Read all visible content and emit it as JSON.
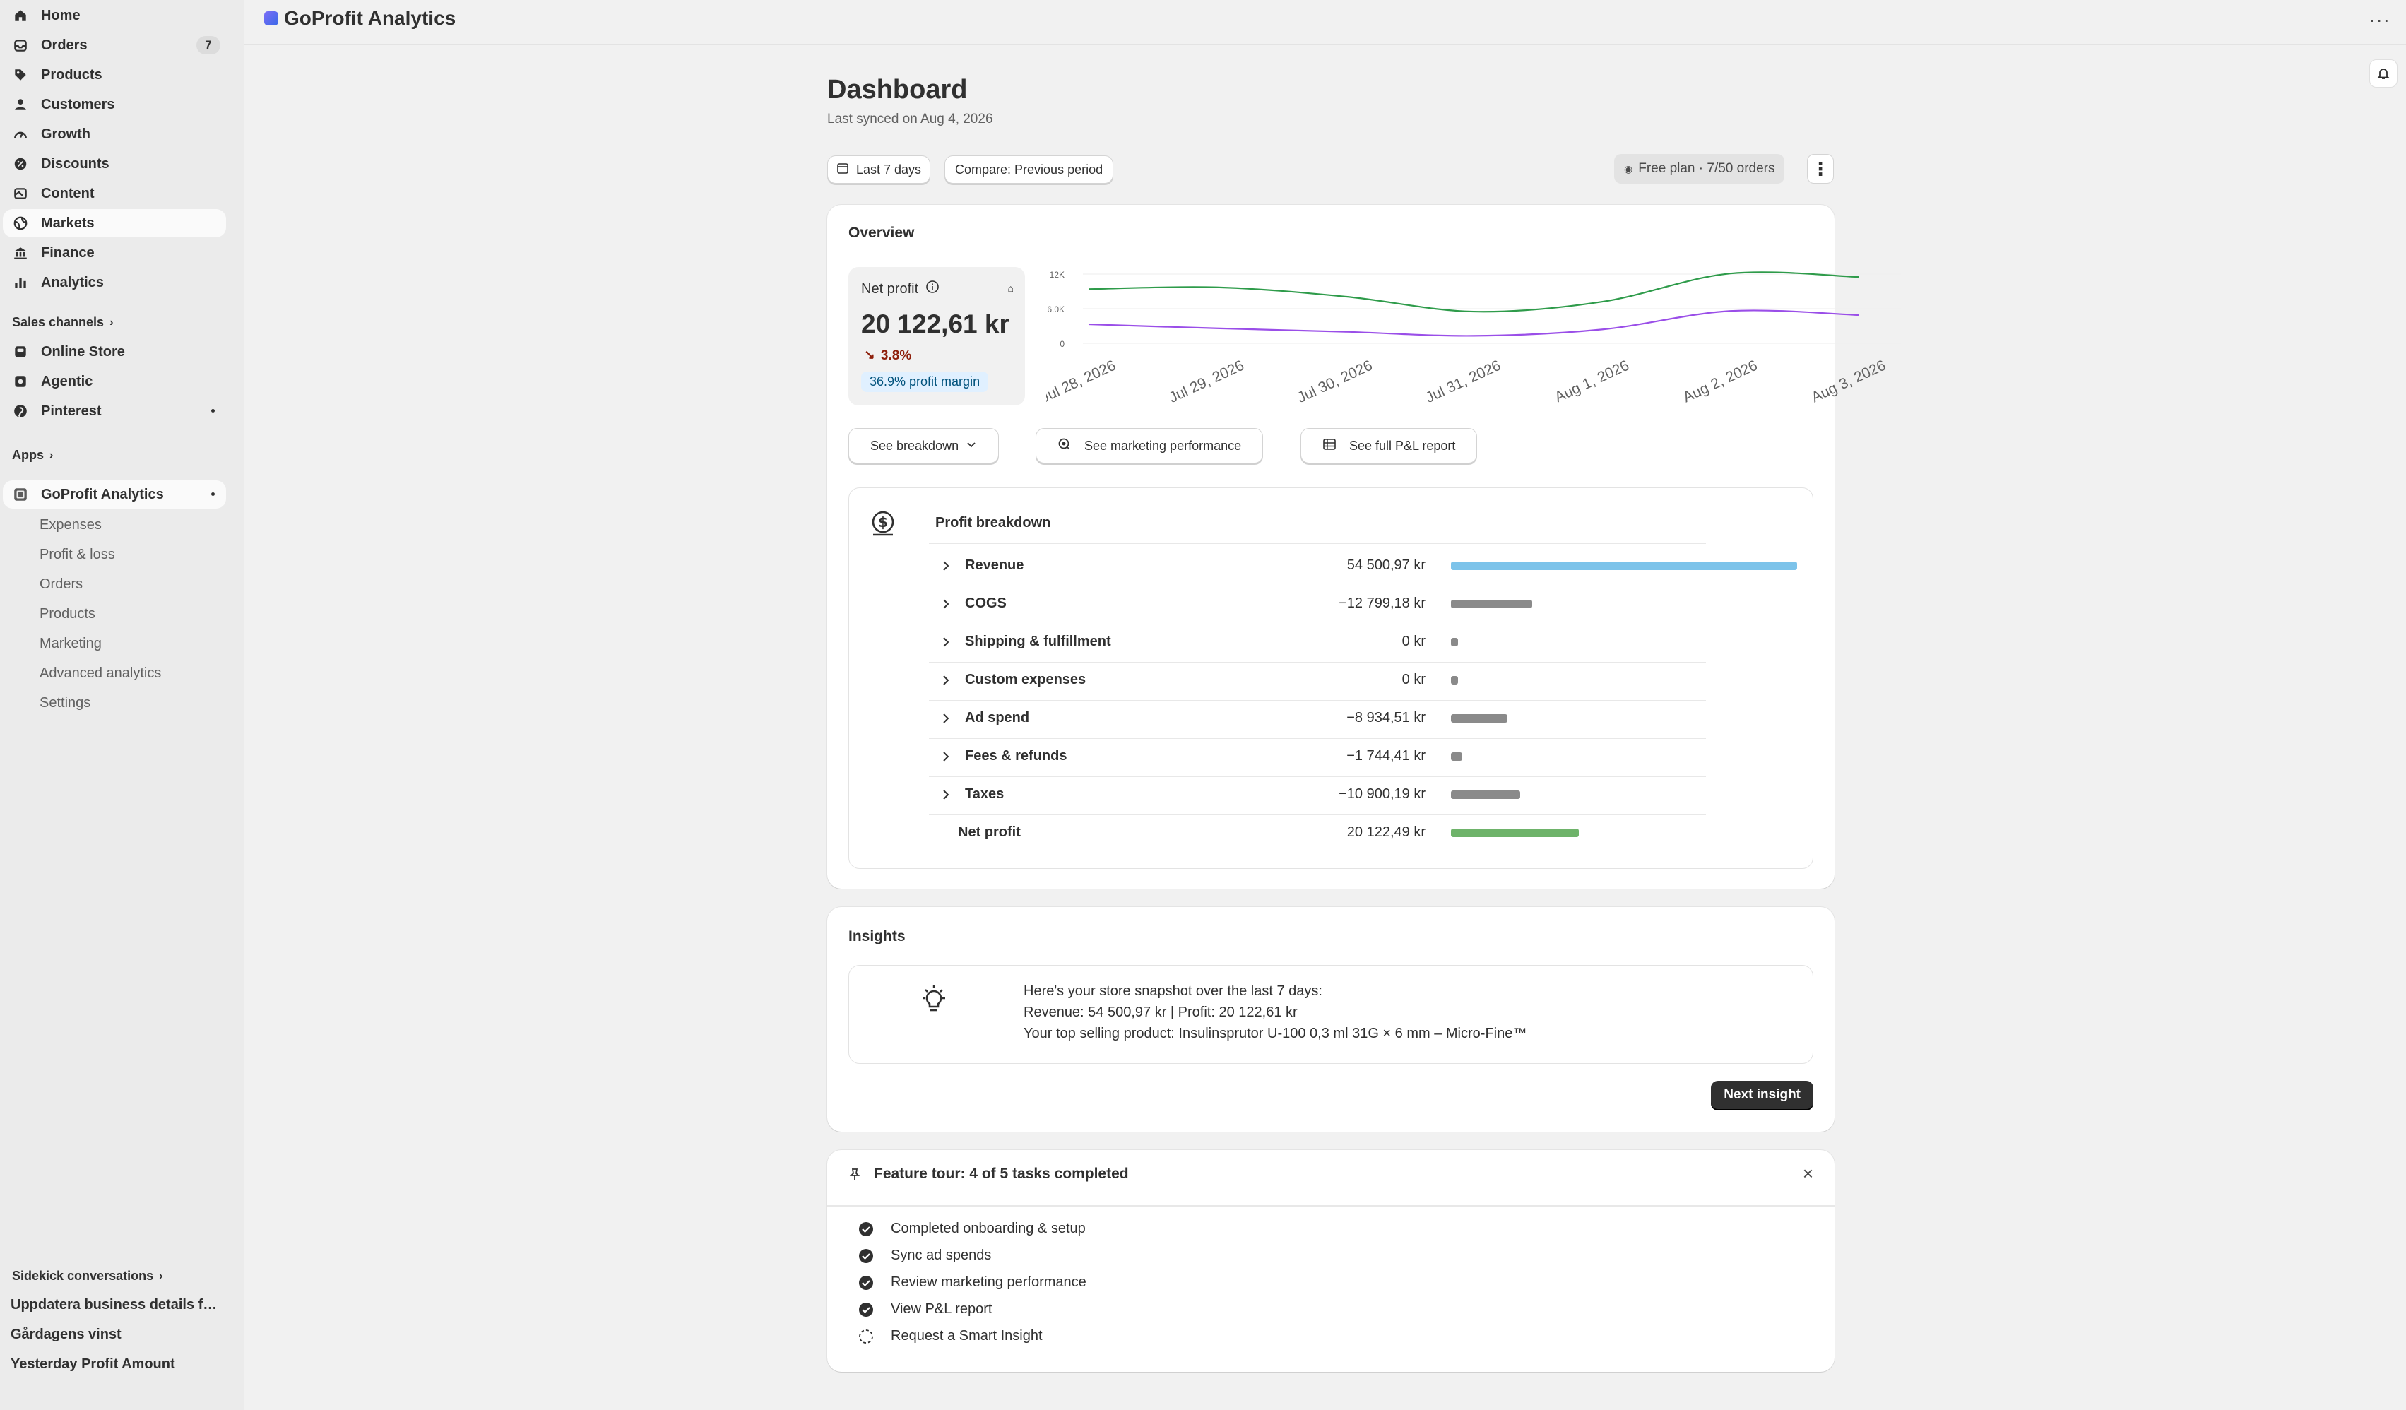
{
  "sidebar": {
    "items": [
      {
        "label": "Home",
        "icon": "home-icon"
      },
      {
        "label": "Orders",
        "icon": "orders-icon",
        "badge": "7"
      },
      {
        "label": "Products",
        "icon": "tag-icon"
      },
      {
        "label": "Customers",
        "icon": "person-icon"
      },
      {
        "label": "Growth",
        "icon": "gauge-icon"
      },
      {
        "label": "Discounts",
        "icon": "discount-icon"
      },
      {
        "label": "Content",
        "icon": "content-icon"
      },
      {
        "label": "Markets",
        "icon": "globe-icon"
      },
      {
        "label": "Finance",
        "icon": "bank-icon"
      },
      {
        "label": "Analytics",
        "icon": "bar-chart-icon"
      }
    ],
    "sales_channels_label": "Sales channels",
    "channels": [
      {
        "label": "Online Store"
      },
      {
        "label": "Agentic"
      },
      {
        "label": "Pinterest"
      }
    ],
    "apps_label": "Apps",
    "app": {
      "label": "GoProfit Analytics",
      "sub_items": [
        "Expenses",
        "Profit & loss",
        "Orders",
        "Products",
        "Marketing",
        "Advanced analytics",
        "Settings"
      ]
    },
    "sidekick_label": "Sidekick conversations",
    "conversations": [
      "Uppdatera business details fö...",
      "Gårdagens vinst",
      "Yesterday Profit Amount"
    ]
  },
  "topbar": {
    "title": "GoProfit Analytics",
    "more_glyph": "···"
  },
  "dashboard": {
    "title": "Dashboard",
    "last_synced": "Last synced on Aug 4, 2026",
    "date_range": "Last 7 days",
    "compare": "Compare: Previous period",
    "plan": "Free plan · 7/50 orders"
  },
  "overview": {
    "title": "Overview",
    "metric_label": "Net profit",
    "metric_value": "20 122,61 kr",
    "change": "3.8%",
    "margin": "36.9% profit margin",
    "buttons": {
      "breakdown": "See breakdown",
      "marketing": "See marketing performance",
      "report": "See full P&L report"
    }
  },
  "chart_data": {
    "type": "line",
    "x": [
      "Jul 28, 2026",
      "Jul 29, 2026",
      "Jul 30, 2026",
      "Jul 31, 2026",
      "Aug 1, 2026",
      "Aug 2, 2026",
      "Aug 3, 2026"
    ],
    "yticks": [
      "12K",
      "6.0K",
      "0"
    ],
    "ylim": [
      0,
      12000
    ],
    "series": [
      {
        "color": "#2e9b4a",
        "values": [
          9400,
          9700,
          8100,
          5500,
          7200,
          12100,
          11500
        ]
      },
      {
        "color": "#9a4ee8",
        "values": [
          3300,
          2600,
          2000,
          1300,
          2400,
          5600,
          4900
        ]
      }
    ],
    "grid": true
  },
  "profit_breakdown": {
    "title": "Profit breakdown",
    "rows": [
      {
        "label": "Revenue",
        "value": "54 500,97 kr",
        "amount": 54500.97,
        "color": "#7cc3ea"
      },
      {
        "label": "COGS",
        "value": "−12 799,18 kr",
        "amount": 12799.18,
        "color": "#8a8a8a"
      },
      {
        "label": "Shipping & fulfillment",
        "value": "0 kr",
        "amount": 0,
        "color": "#8a8a8a"
      },
      {
        "label": "Custom expenses",
        "value": "0 kr",
        "amount": 0,
        "color": "#8a8a8a"
      },
      {
        "label": "Ad spend",
        "value": "−8 934,51 kr",
        "amount": 8934.51,
        "color": "#8a8a8a"
      },
      {
        "label": "Fees & refunds",
        "value": "−1 744,41 kr",
        "amount": 1744.41,
        "color": "#8a8a8a"
      },
      {
        "label": "Taxes",
        "value": "−10 900,19 kr",
        "amount": 10900.19,
        "color": "#8a8a8a"
      }
    ],
    "total": {
      "label": "Net profit",
      "value": "20 122,49 kr",
      "amount": 20122.49,
      "color": "#6eb36a"
    }
  },
  "insights": {
    "title": "Insights",
    "lines": [
      "Here's your store snapshot over the last 7 days:",
      "Revenue: 54 500,97 kr | Profit: 20 122,61 kr",
      "Your top selling product: Insulinsprutor U-100 0,3 ml 31G × 6 mm – Micro-Fine™"
    ],
    "next_label": "Next insight"
  },
  "tour": {
    "title": "Feature tour: 4 of 5 tasks completed",
    "tasks": [
      {
        "label": "Completed onboarding & setup",
        "done": true
      },
      {
        "label": "Sync ad spends",
        "done": true
      },
      {
        "label": "Review marketing performance",
        "done": true
      },
      {
        "label": "View P&L report",
        "done": true
      },
      {
        "label": "Request a Smart Insight",
        "done": false
      }
    ]
  }
}
